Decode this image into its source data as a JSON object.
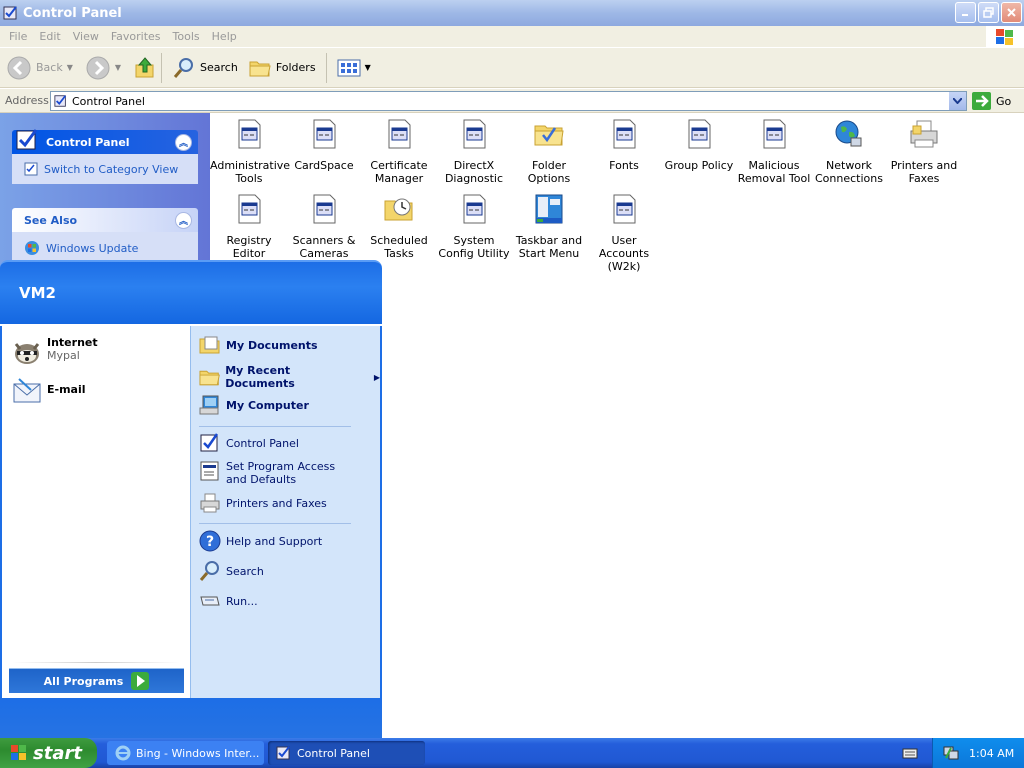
{
  "window": {
    "title": "Control Panel"
  },
  "menu": [
    "File",
    "Edit",
    "View",
    "Favorites",
    "Tools",
    "Help"
  ],
  "toolbar": {
    "back": "Back",
    "search": "Search",
    "folders": "Folders"
  },
  "address": {
    "label": "Address",
    "value": "Control Panel",
    "go": "Go"
  },
  "taskpane": {
    "control_panel": {
      "title": "Control Panel",
      "link": "Switch to Category View"
    },
    "see_also": {
      "title": "See Also",
      "link": "Windows Update"
    }
  },
  "items": [
    "Administrative Tools",
    "CardSpace",
    "Certificate Manager",
    "DirectX Diagnostic",
    "Folder Options",
    "Fonts",
    "Group Policy",
    "Malicious Removal Tool",
    "Network Connections",
    "Printers and Faxes",
    "Registry Editor",
    "Scanners & Cameras",
    "Scheduled Tasks",
    "System Config Utility",
    "Taskbar and Start Menu",
    "User Accounts (W2k)"
  ],
  "startmenu": {
    "user": "VM2",
    "pinned": [
      {
        "title": "Internet",
        "sub": "Mypal"
      },
      {
        "title": "E-mail",
        "sub": ""
      }
    ],
    "all_programs": "All Programs",
    "right": {
      "my_documents": "My Documents",
      "my_recent": "My Recent Documents",
      "my_computer": "My Computer",
      "control_panel": "Control Panel",
      "set_program": "Set Program Access and Defaults",
      "printers": "Printers and Faxes",
      "help": "Help and Support",
      "search": "Search",
      "run": "Run..."
    }
  },
  "taskbar": {
    "start": "start",
    "buttons": [
      "Bing - Windows Inter...",
      "Control Panel"
    ],
    "clock": "1:04 AM"
  }
}
